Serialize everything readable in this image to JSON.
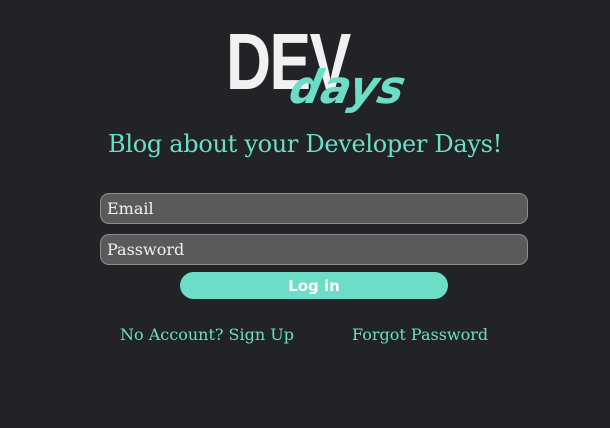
{
  "logo": {
    "primary": "DEV",
    "secondary": "days"
  },
  "tagline": "Blog about your Developer Days!",
  "form": {
    "email_placeholder": "Email",
    "password_placeholder": "Password",
    "login_label": "Log in"
  },
  "links": {
    "signup": "No Account? Sign Up",
    "forgot": "Forgot Password"
  },
  "colors": {
    "background": "#222327",
    "accent": "#6cdec8",
    "field_bg": "#5a5a5b"
  }
}
